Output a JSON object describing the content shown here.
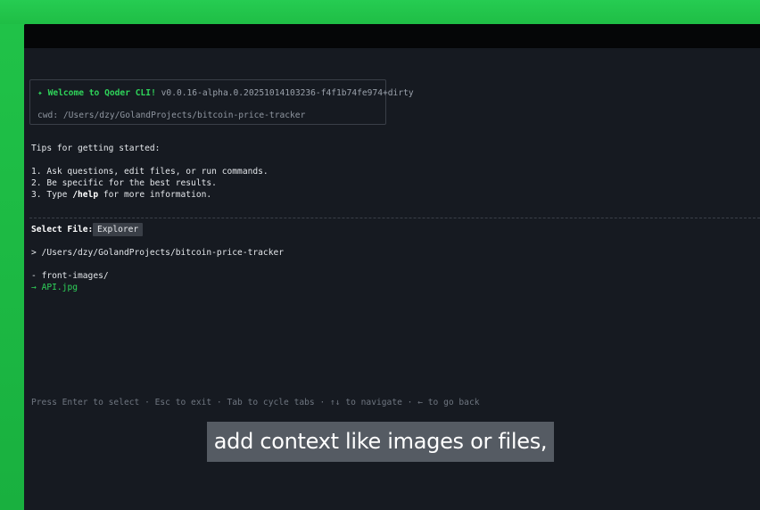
{
  "welcome": {
    "star": "✦",
    "brand": "Welcome to Qoder CLI!",
    "version": "v0.0.16-alpha.0.20251014103236-f4f1b74fe974+dirty",
    "cwd": "cwd: /Users/dzy/GolandProjects/bitcoin-price-tracker"
  },
  "tips": {
    "heading": "Tips for getting started:",
    "items": [
      "1. Ask questions, edit files, or run commands.",
      "2. Be specific for the best results."
    ],
    "item3_prefix": "3. Type ",
    "item3_command": "/help",
    "item3_suffix": " for more information."
  },
  "file_picker": {
    "label": "Select File:",
    "tab": "Explorer",
    "current_path": "> /Users/dzy/GolandProjects/bitcoin-price-tracker",
    "entries": [
      {
        "prefix": "- ",
        "name": "front-images/",
        "selected": false
      },
      {
        "prefix": "→ ",
        "name": "API.jpg",
        "selected": true
      }
    ]
  },
  "hints": "Press Enter to select · Esc to exit · Tab to cycle tabs · ↑↓ to navigate · ← to go back",
  "caption": "add context like images or files,",
  "colors": {
    "background_green": "#22c34a",
    "terminal_bg": "#161a21",
    "accent_green": "#2fd35a",
    "titlebar": "#050607"
  }
}
